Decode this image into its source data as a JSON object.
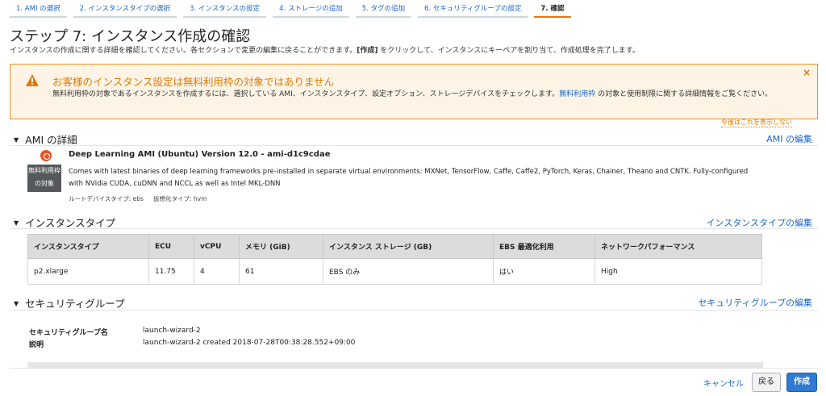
{
  "steps": [
    {
      "label": "1. AMI の選択"
    },
    {
      "label": "2. インスタンスタイプの選択"
    },
    {
      "label": "3. インスタンスの設定"
    },
    {
      "label": "4. ストレージの追加"
    },
    {
      "label": "5. タグの追加"
    },
    {
      "label": "6. セキュリティグループの設定"
    },
    {
      "label": "7. 確認"
    }
  ],
  "page": {
    "title": "ステップ 7: インスタンス作成の確認",
    "intro_before": "インスタンスの作成に関する詳細を確認してください。各セクションで変更の編集に戻ることができます。",
    "intro_bold": "[作成]",
    "intro_after": " をクリックして、インスタンスにキーペアを割り当て、作成処理を完了します。"
  },
  "warning": {
    "title": "お客様のインスタンス設定は無料利用枠の対象ではありません",
    "body_before": "無料利用枠の対象であるインスタンスを作成するには、選択している AMI、インスタンスタイプ、設定オプション、ストレージデバイスをチェックします。",
    "link": "無料利用枠",
    "body_after": " の対象と使用制限に関する詳細情報をご覧ください。",
    "close": "×",
    "dont_show": "今後はこれを表示しない"
  },
  "ami": {
    "header": "AMI の詳細",
    "edit": "AMI の編集",
    "badge_line1": "無料利用枠",
    "badge_line2": "の対象",
    "name": "Deep Learning AMI (Ubuntu) Version 12.0 - ami-d1c9cdae",
    "description": "Comes with latest binaries of deep learning frameworks pre-installed in separate virtual environments: MXNet, TensorFlow, Caffe, Caffe2, PyTorch, Keras, Chainer, Theano and CNTK. Fully-configured with NVidia CUDA, cuDNN and NCCL as well as Intel MKL-DNN",
    "root_device": "ルートデバイスタイプ: ebs",
    "virtualization": "仮想化タイプ: hvm"
  },
  "instance_type": {
    "header": "インスタンスタイプ",
    "edit": "インスタンスタイプの編集",
    "columns": [
      "インスタンスタイプ",
      "ECU",
      "vCPU",
      "メモリ (GiB)",
      "インスタンス ストレージ (GB)",
      "EBS 最適化利用",
      "ネットワークパフォーマンス"
    ],
    "rows": [
      [
        "p2.xlarge",
        "11.75",
        "4",
        "61",
        "EBS のみ",
        "はい",
        "High"
      ]
    ]
  },
  "security": {
    "header": "セキュリティグループ",
    "edit": "セキュリティグループの編集",
    "name_label": "セキュリティグループ名",
    "name_value": "launch-wizard-2",
    "desc_label": "説明",
    "desc_value": "launch-wizard-2 created 2018-07-28T00:38:28.552+09:00"
  },
  "footer": {
    "cancel": "キャンセル",
    "back": "戻る",
    "create": "作成"
  },
  "colors": {
    "accent": "#e47911",
    "link": "#1a66c9",
    "primary_button": "#2f7ad4",
    "warning_border": "#eb8f19",
    "warning_bg": "#fdf4e6"
  }
}
